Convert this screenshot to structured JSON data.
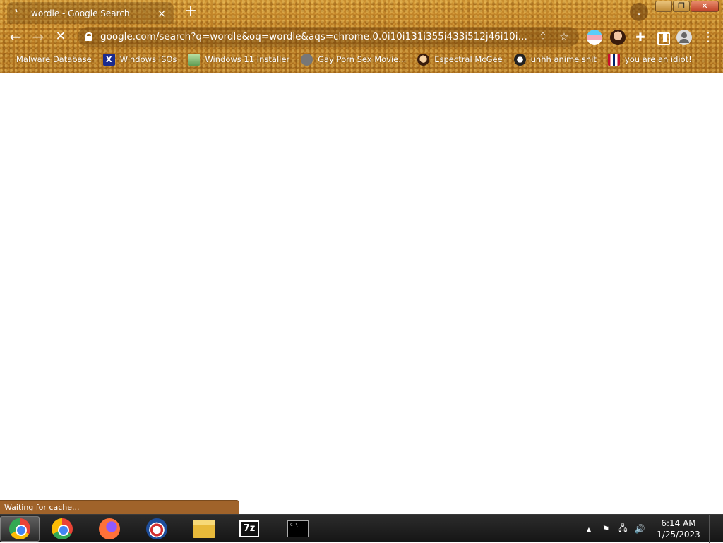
{
  "browser": {
    "tab_title": "wordle - Google Search",
    "tab_close": "×",
    "new_tab": "+",
    "tab_search": "⌄",
    "window": {
      "minimize": "−",
      "maximize": "❐",
      "close": "✕"
    },
    "nav": {
      "back": "←",
      "forward": "→",
      "stop": "✕"
    },
    "url": "google.com/search?q=wordle&oq=wordle&aqs=chrome.0.0i10i131i355i433i512j46i10i131i433...",
    "omnibox_icons": {
      "share": "⇪",
      "bookmark_star": "☆"
    },
    "extensions": {
      "puzzle": "✚",
      "menu": "⋮"
    },
    "bookmarks": [
      {
        "label": "Malware Database",
        "icon": ""
      },
      {
        "label": "Windows ISOs",
        "icon": "X"
      },
      {
        "label": "Windows 11 Installer",
        "icon": ""
      },
      {
        "label": "Gay Porn Sex Movie...",
        "icon": ""
      },
      {
        "label": "Espectral McGee",
        "icon": ""
      },
      {
        "label": "uhhh anime shit",
        "icon": ""
      },
      {
        "label": "you are an idiot!",
        "icon": ""
      }
    ]
  },
  "status": {
    "text": "Waiting for cache..."
  },
  "taskbar": {
    "apps": [
      {
        "name": "Chrome Canary",
        "active": true
      },
      {
        "name": "Google Chrome",
        "active": false
      },
      {
        "name": "Firefox",
        "active": false
      },
      {
        "name": "Obama browser",
        "active": false
      },
      {
        "name": "File Explorer",
        "active": false
      },
      {
        "name": "7-Zip",
        "label": "7z",
        "active": false
      },
      {
        "name": "Command Prompt",
        "label": "C:\\_",
        "active": false
      }
    ],
    "tray": {
      "chevron": "▲",
      "flag": "⚑",
      "network": "🖧",
      "volume": "🔊"
    },
    "time": "6:14 AM",
    "date": "1/25/2023"
  }
}
